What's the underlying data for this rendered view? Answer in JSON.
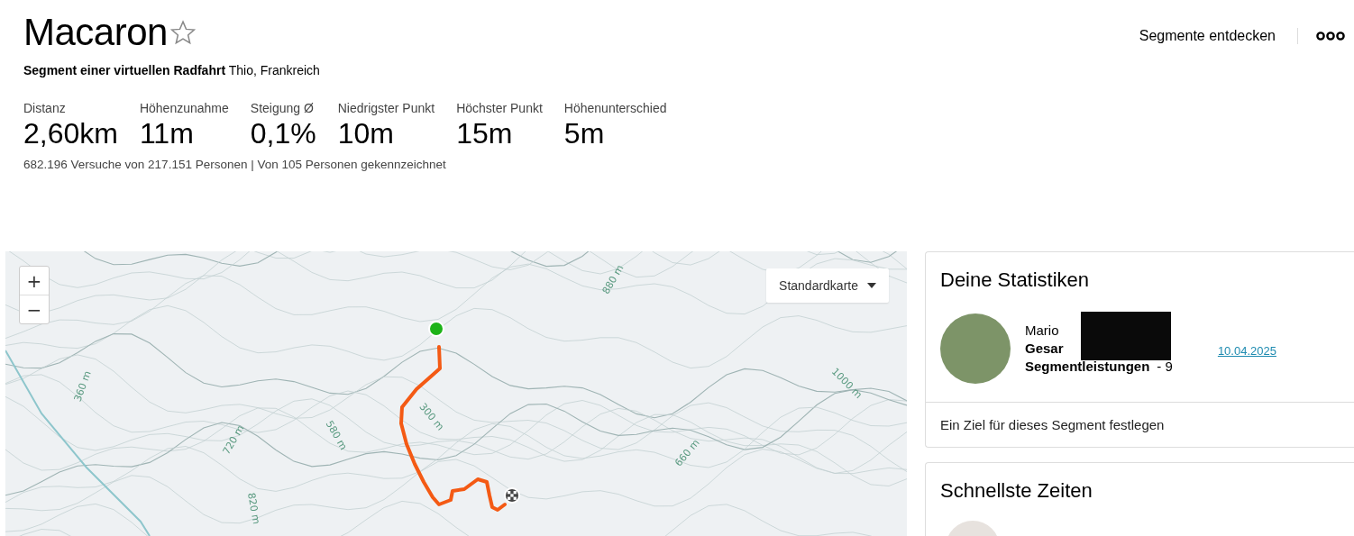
{
  "header": {
    "title": "Macaron",
    "starred": false,
    "subtitle_bold": "Segment einer virtuellen Radfahrt",
    "location": "Thio, Frankreich",
    "discover_link": "Segmente entdecken"
  },
  "stats": [
    {
      "label": "Distanz",
      "value": "2,60km"
    },
    {
      "label": "Höhenzunahme",
      "value": "11m"
    },
    {
      "label": "Steigung Ø",
      "value": "0,1%"
    },
    {
      "label": "Niedrigster Punkt",
      "value": "10m"
    },
    {
      "label": "Höchster Punkt",
      "value": "15m"
    },
    {
      "label": "Höhenunterschied",
      "value": "5m"
    }
  ],
  "attempts": "682.196 Versuche von 217.151 Personen | Von 105 Personen gekennzeichnet",
  "map": {
    "zoom_in": "+",
    "zoom_out": "−",
    "map_type": "Standardkarte",
    "elevation_labels": [
      "360 m",
      "720 m",
      "580 m",
      "820 m",
      "880 m",
      "1000 m",
      "660 m",
      "300 m"
    ]
  },
  "your_stats": {
    "title": "Deine Statistiken",
    "name": "Mario",
    "line_2": "Gesar",
    "line_3": "Segmentleistungen",
    "line_3_value": "- 9",
    "date": "10.04.2025",
    "goal_link": "Ein Ziel für dieses Segment festlegen"
  },
  "fastest_times": {
    "title": "Schnellste Zeiten"
  }
}
